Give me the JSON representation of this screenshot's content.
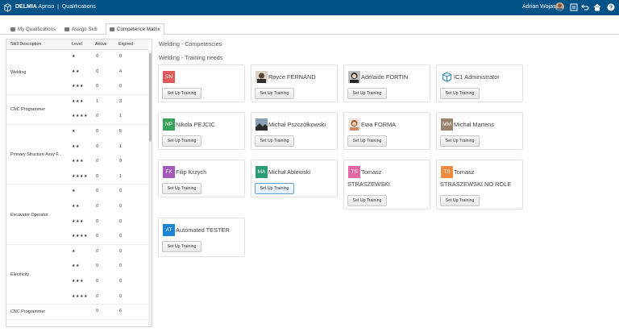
{
  "header": {
    "brand": "DELMIA",
    "app": "Apriso",
    "separator": "|",
    "module": "Qualifications",
    "user": "Adrian Wojas",
    "icons": [
      "user-avatar",
      "info-panel-icon",
      "back-icon",
      "home-icon",
      "help-icon"
    ],
    "color": "#005386"
  },
  "tabs": [
    {
      "label": "My Qualifications",
      "icon": "list-icon"
    },
    {
      "label": "Assign Skill",
      "icon": "link-icon"
    },
    {
      "label": "Competence Matrix",
      "icon": "matrix-icon",
      "active": true
    }
  ],
  "matrix": {
    "headers": {
      "skill": "Skill Description",
      "level": "Level",
      "active": "Active",
      "expired": "Expired"
    },
    "groups": [
      {
        "name": "Welding",
        "rows": [
          {
            "level": "★",
            "active": "0",
            "expired": "8"
          },
          {
            "level": "★★",
            "active": "0",
            "expired": "4"
          },
          {
            "level": "★★★",
            "active": "0",
            "expired": "0"
          }
        ]
      },
      {
        "name": "CNC Programmer",
        "rows": [
          {
            "level": "★★★",
            "active": "1",
            "expired": "3"
          },
          {
            "level": "★★★★",
            "active": "0",
            "expired": "1"
          }
        ]
      },
      {
        "name": "Primary Structure Assy F...",
        "rows": [
          {
            "level": "★",
            "active": "0",
            "expired": "5"
          },
          {
            "level": "★★",
            "active": "0",
            "expired": "1"
          },
          {
            "level": "★★★",
            "active": "0",
            "expired": "9"
          },
          {
            "level": "★★★★",
            "active": "0",
            "expired": "1"
          }
        ]
      },
      {
        "name": "Excavator Operator",
        "rows": [
          {
            "level": "★",
            "active": "0",
            "expired": "0"
          },
          {
            "level": "★★",
            "active": "0",
            "expired": "0"
          },
          {
            "level": "★★★",
            "active": "0",
            "expired": "0"
          },
          {
            "level": "★★★★",
            "active": "0",
            "expired": "0"
          }
        ]
      },
      {
        "name": "Electricity",
        "rows": [
          {
            "level": "★",
            "active": "0",
            "expired": "0"
          },
          {
            "level": "★★",
            "active": "0",
            "expired": "0"
          },
          {
            "level": "★★★",
            "active": "0",
            "expired": "0"
          },
          {
            "level": "★★★★",
            "active": "0",
            "expired": "0"
          }
        ]
      },
      {
        "name": "CNC Programmer",
        "rows": [
          {
            "level": "",
            "active": "0",
            "expired": "6"
          }
        ]
      }
    ]
  },
  "main": {
    "title": "Welding - Competencies",
    "subtitle": "Welding - Training needs",
    "button_label": "Set Up Training",
    "people": [
      {
        "initials": "SN",
        "color": "#e05a5a",
        "name": "",
        "name2": ""
      },
      {
        "initials": "",
        "photo": "photo-man-1",
        "name": "Royce FERNAND",
        "name2": ""
      },
      {
        "initials": "",
        "photo": "photo-woman-1",
        "name": "Adélaide FORTIN",
        "name2": ""
      },
      {
        "initials": "",
        "photo": "cube-icon",
        "name": "IC1 Administrator",
        "name2": ""
      },
      {
        "initials": "NP",
        "color": "#3aa35b",
        "name": "Nikola PEJCIC",
        "name2": ""
      },
      {
        "initials": "",
        "photo": "photo-landscape",
        "name": "Michał Pszczółkowski",
        "name2": ""
      },
      {
        "initials": "",
        "photo": "photo-woman-2",
        "name": "Ewa FORMA",
        "name2": ""
      },
      {
        "initials": "MM",
        "color": "#9b826b",
        "name": "Michał Martens",
        "name2": ""
      },
      {
        "initials": "FK",
        "color": "#a45bbd",
        "name": "Filip Krzych",
        "name2": ""
      },
      {
        "initials": "MA",
        "color": "#2a9c73",
        "name": "Michał Ablewski",
        "name2": ""
      },
      {
        "initials": "TS",
        "color": "#e269a6",
        "name": "Tomasz",
        "name2": "STRASZEWSKI"
      },
      {
        "initials": "TS",
        "color": "#f08a3c",
        "name": "Tomasz",
        "name2": "STRASZEWSKI NO ROLE"
      },
      {
        "initials": "AT",
        "color": "#1c86d6",
        "name": "Automated TESTER",
        "name2": ""
      }
    ]
  }
}
